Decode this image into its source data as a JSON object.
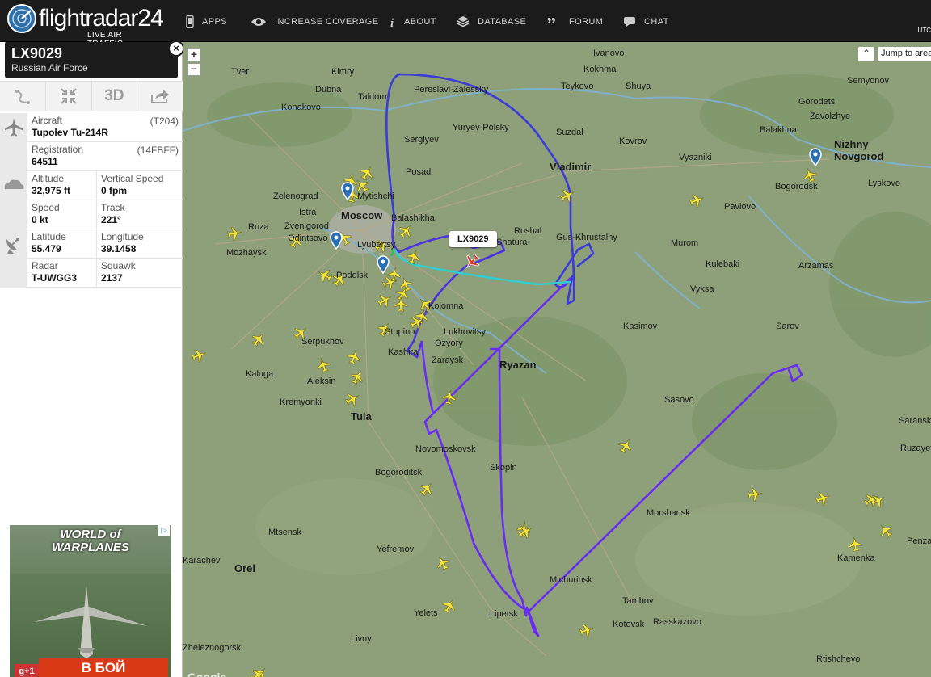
{
  "app": {
    "brand": "flightradar24",
    "tagline": "LIVE AIR TRAFFIC",
    "utc_label": "UTC"
  },
  "nav": [
    {
      "label": "APPS",
      "icon": "phone-icon"
    },
    {
      "label": "INCREASE COVERAGE",
      "icon": "eye-icon"
    },
    {
      "label": "ABOUT",
      "icon": "info-icon"
    },
    {
      "label": "DATABASE",
      "icon": "database-icon"
    },
    {
      "label": "FORUM",
      "icon": "quote-icon"
    },
    {
      "label": "CHAT",
      "icon": "chat-icon"
    }
  ],
  "flight": {
    "callsign": "LX9029",
    "operator": "Russian Air Force",
    "close_symbol": "×",
    "tools": [
      {
        "label": "",
        "icon": "route-icon"
      },
      {
        "label": "",
        "icon": "collapse-icon"
      },
      {
        "label": "3D",
        "icon": ""
      },
      {
        "label": "",
        "icon": "share-icon"
      }
    ],
    "details": {
      "aircraft_label": "Aircraft",
      "aircraft_code": "(T204)",
      "aircraft_value": "Tupolev Tu-214R",
      "registration_label": "Registration",
      "registration_code": "(14FBFF)",
      "registration_value": "64511",
      "altitude_label": "Altitude",
      "altitude_value": "32,975 ft",
      "vspeed_label": "Vertical Speed",
      "vspeed_value": "0 fpm",
      "speed_label": "Speed",
      "speed_value": "0 kt",
      "track_label": "Track",
      "track_value": "221°",
      "latitude_label": "Latitude",
      "latitude_value": "55.479",
      "longitude_label": "Longitude",
      "longitude_value": "39.1458",
      "radar_label": "Radar",
      "radar_value": "T-UWGG3",
      "squawk_label": "Squawk",
      "squawk_value": "2137"
    }
  },
  "ad": {
    "title": "WORLD of WARPLANES",
    "cta": "В БОЙ",
    "gplus": "g+1",
    "adchoices": "▷"
  },
  "map": {
    "zoom_in": "+",
    "zoom_out": "−",
    "jump_label": "Jump to area",
    "jump_icon": "chevron-up-icon",
    "flight_label": "LX9029",
    "google": "Google",
    "colors": {
      "land": "#8ea07a",
      "track_blue": "#3b3bd8",
      "track_violet": "#6a2cf0",
      "track_cyan": "#33ccd0",
      "plane": "#f3e33c"
    },
    "places": [
      {
        "name": "Ivanovo"
      },
      {
        "name": "Kokhma"
      },
      {
        "name": "Tver"
      },
      {
        "name": "Kimry"
      },
      {
        "name": "Semyonov"
      },
      {
        "name": "Dubna"
      },
      {
        "name": "Taldom"
      },
      {
        "name": "Pereslavl-Zalessky"
      },
      {
        "name": "Teykovo"
      },
      {
        "name": "Shuya"
      },
      {
        "name": "Gorodets"
      },
      {
        "name": "Konakovo"
      },
      {
        "name": "Zavolzhye"
      },
      {
        "name": "Balakhna"
      },
      {
        "name": "Yuryev-Polsky"
      },
      {
        "name": "Suzdal"
      },
      {
        "name": "Kovrov"
      },
      {
        "name": "Nizhny"
      },
      {
        "name": "Novgorod"
      },
      {
        "name": "Sergiyev"
      },
      {
        "name": "Posad"
      },
      {
        "name": "Vladimir"
      },
      {
        "name": "Vyazniki"
      },
      {
        "name": "Bogorodsk"
      },
      {
        "name": "Lyskovo"
      },
      {
        "name": "Zelenograd"
      },
      {
        "name": "Mytishchi"
      },
      {
        "name": "Istra"
      },
      {
        "name": "Balashikha"
      },
      {
        "name": "Zvenigorod"
      },
      {
        "name": "Moscow"
      },
      {
        "name": "Ruza"
      },
      {
        "name": "Odintsovo"
      },
      {
        "name": "Lyubertsy"
      },
      {
        "name": "Roshal"
      },
      {
        "name": "Gus-Khrustalny"
      },
      {
        "name": "Pavlovo"
      },
      {
        "name": "Murom"
      },
      {
        "name": "Mozhaysk"
      },
      {
        "name": "Podolsk"
      },
      {
        "name": "Shatura"
      },
      {
        "name": "Kulebaki"
      },
      {
        "name": "Arzamas"
      },
      {
        "name": "Vyksa"
      },
      {
        "name": "Kolomna"
      },
      {
        "name": "Kasimov"
      },
      {
        "name": "Serpukhov"
      },
      {
        "name": "Stupino"
      },
      {
        "name": "Lukhovitsy"
      },
      {
        "name": "Kashira"
      },
      {
        "name": "Ozyory"
      },
      {
        "name": "Sarov"
      },
      {
        "name": "Zaraysk"
      },
      {
        "name": "Ryazan"
      },
      {
        "name": "Kaluga"
      },
      {
        "name": "Aleksin"
      },
      {
        "name": "Kremyonki"
      },
      {
        "name": "Sasovo"
      },
      {
        "name": "Tula"
      },
      {
        "name": "Saransk"
      },
      {
        "name": "Novomoskovsk"
      },
      {
        "name": "Ruzayevka"
      },
      {
        "name": "Skopin"
      },
      {
        "name": "Bogoroditsk"
      },
      {
        "name": "Morshansk"
      },
      {
        "name": "Penza"
      },
      {
        "name": "Mtsensk"
      },
      {
        "name": "Yefremov"
      },
      {
        "name": "Kamenka"
      },
      {
        "name": "Orel"
      },
      {
        "name": "Michurinsk"
      },
      {
        "name": "Tambov"
      },
      {
        "name": "Yelets"
      },
      {
        "name": "Lipetsk"
      },
      {
        "name": "Kotovsk"
      },
      {
        "name": "Rasskazovo"
      },
      {
        "name": "Livny"
      },
      {
        "name": "Zheleznogorsk"
      },
      {
        "name": "Rtishchevo"
      },
      {
        "name": "Karachev"
      }
    ]
  }
}
